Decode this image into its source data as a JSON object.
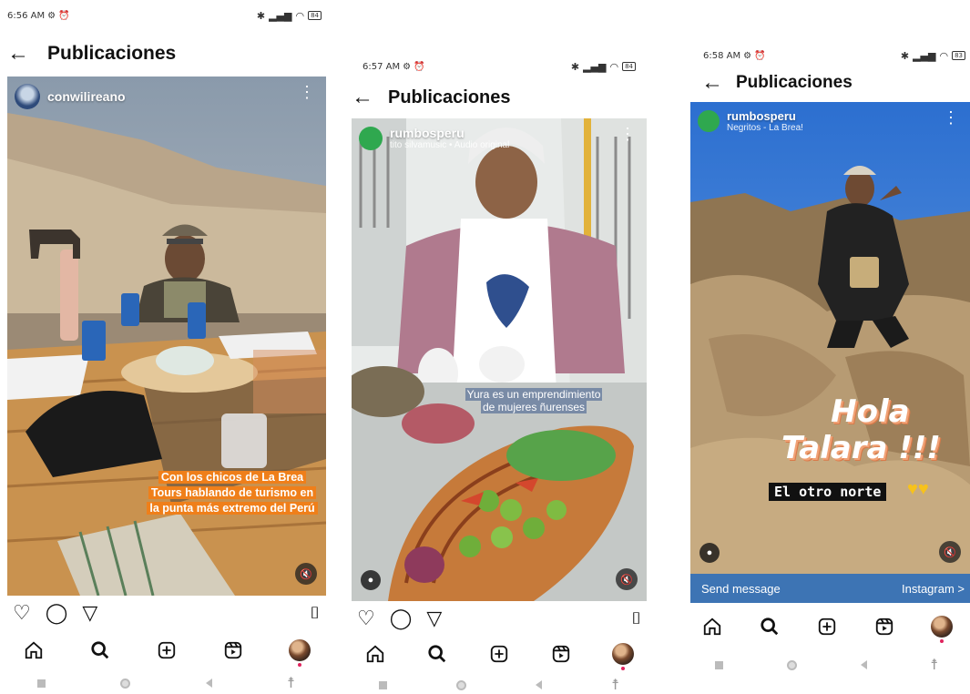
{
  "screens": [
    {
      "status": {
        "time": "6:56 AM",
        "battery": "84"
      },
      "header": {
        "back_icon": "arrow-left-icon",
        "title": "Publicaciones"
      },
      "post": {
        "username": "conwilireano",
        "caption": "Con los chicos de La Brea Tours hablando de turismo en la punta más extremo del Perú"
      }
    },
    {
      "status": {
        "time": "6:57 AM",
        "battery": "84"
      },
      "header": {
        "back_icon": "arrow-left-icon",
        "title": "Publicaciones"
      },
      "post": {
        "username": "rumbosperu",
        "subline": "tito silvamusic • Audio original",
        "caption_line1": "Yura es un emprendimiento",
        "caption_line2": "de mujeres ñurenses"
      }
    },
    {
      "status": {
        "time": "6:58 AM",
        "battery": "83"
      },
      "header": {
        "back_icon": "arrow-left-icon",
        "title": "Publicaciones"
      },
      "post": {
        "username": "rumbosperu",
        "subline": "Negritos - La Brea!",
        "sticker_line1": "Hola",
        "sticker_line2": "Talara !!!",
        "sticker_tag": "El otro norte",
        "send_message": "Send message",
        "instagram_link": "Instagram >"
      }
    }
  ],
  "colors": {
    "accent_orange": "#ef7f1a",
    "send_bar": "#3d74b4",
    "notification_dot": "#e0245e"
  },
  "icons": [
    "heart-icon",
    "comment-icon",
    "send-icon",
    "bookmark-icon",
    "home-icon",
    "search-icon",
    "create-icon",
    "reels-icon",
    "profile-icon",
    "mute-icon",
    "tag-user-icon"
  ]
}
